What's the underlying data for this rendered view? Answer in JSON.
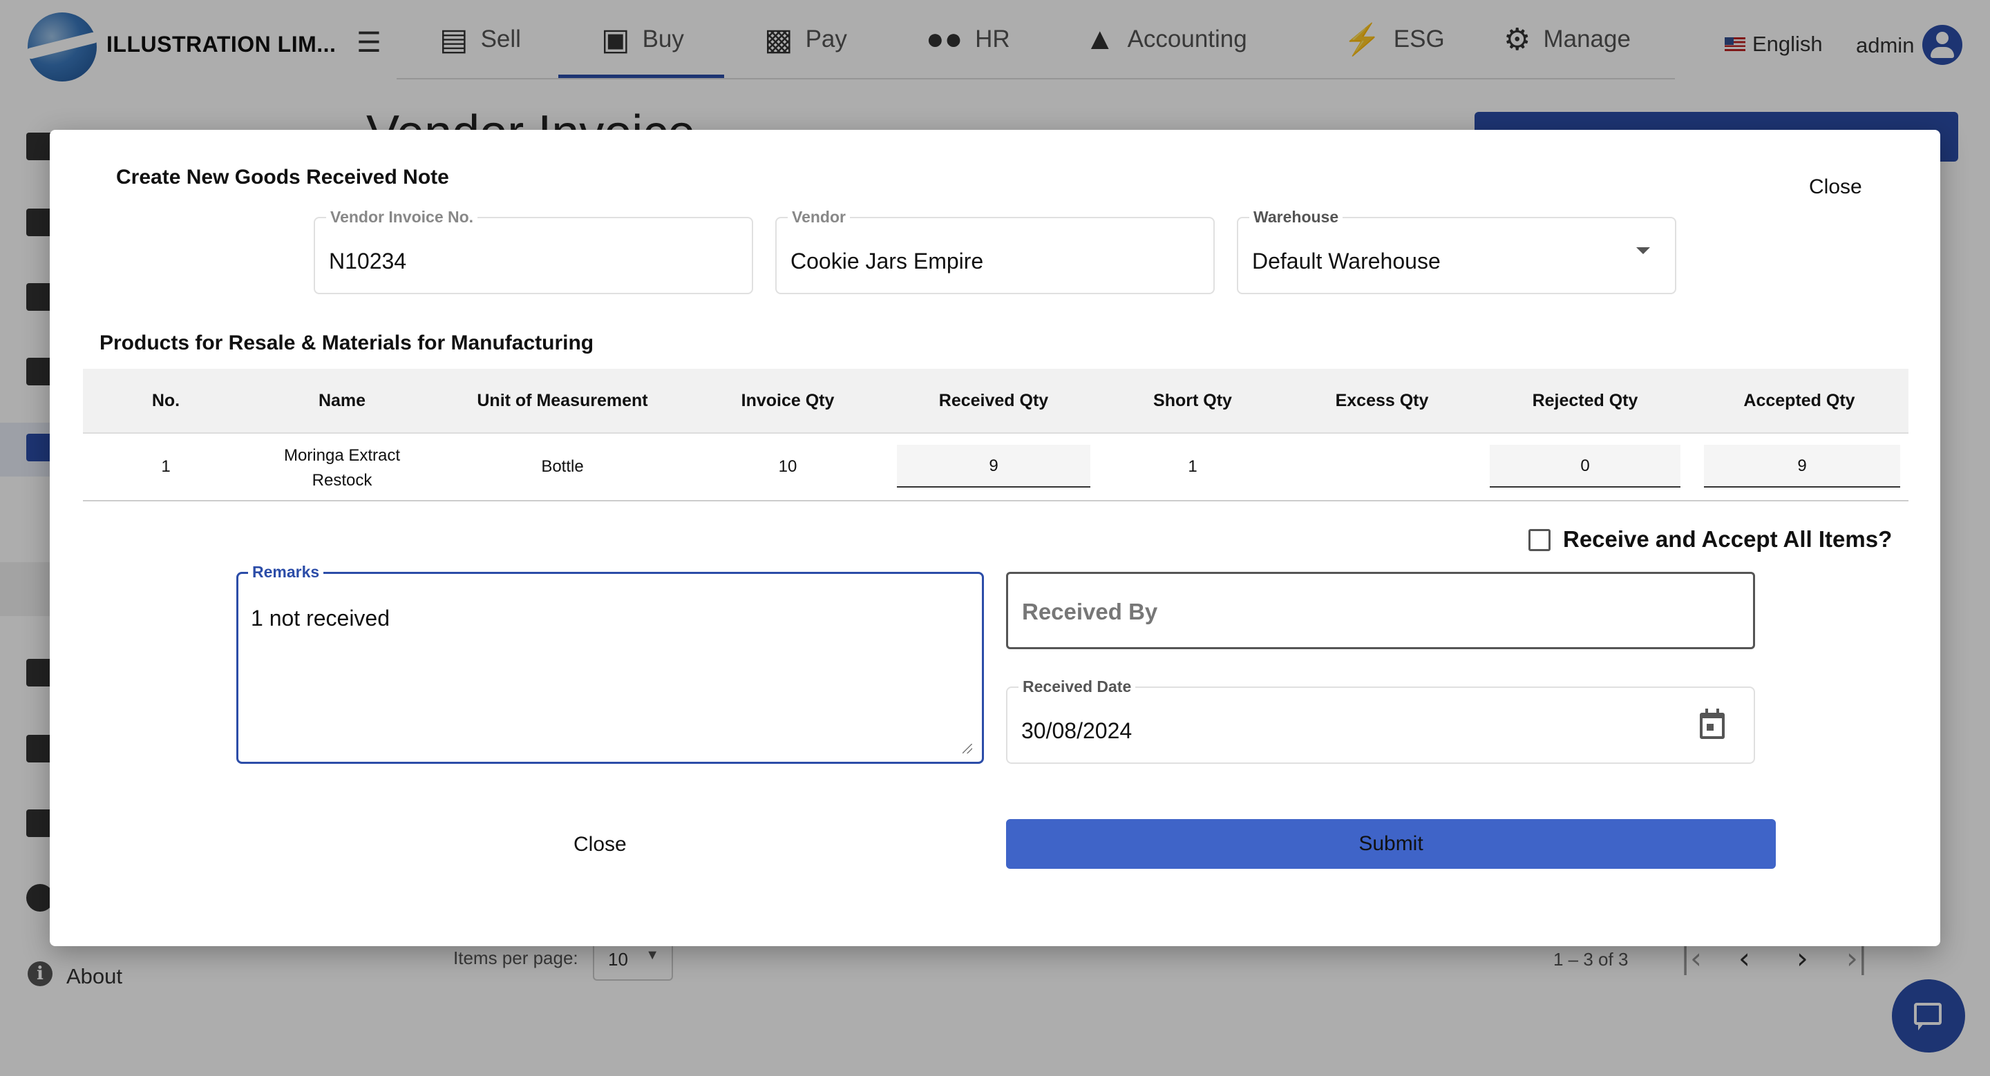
{
  "app": {
    "company_name": "ILLUSTRATION LIM...",
    "menu_icon": "hamburger-menu-icon"
  },
  "nav": {
    "items": [
      {
        "label": "Sell",
        "icon": "store-icon"
      },
      {
        "label": "Buy",
        "icon": "shopping-bag-icon",
        "active": true
      },
      {
        "label": "Pay",
        "icon": "money-icon"
      },
      {
        "label": "HR",
        "icon": "people-icon"
      },
      {
        "label": "Accounting",
        "icon": "bank-icon"
      },
      {
        "label": "ESG",
        "icon": "bolt-icon"
      },
      {
        "label": "Manage",
        "icon": "gears-icon"
      }
    ],
    "language": "English",
    "user": "admin"
  },
  "background_page": {
    "title": "Vendor Invoice",
    "about": "About",
    "items_per_page_label": "Items per page:",
    "items_per_page_value": "10",
    "range_label": "1 – 3 of 3"
  },
  "modal": {
    "title": "Create New Goods Received Note",
    "close_top": "Close",
    "vendor_invoice_no": {
      "label": "Vendor Invoice No.",
      "value": "N10234"
    },
    "vendor": {
      "label": "Vendor",
      "value": "Cookie Jars Empire"
    },
    "warehouse": {
      "label": "Warehouse",
      "value": "Default Warehouse"
    },
    "section_title": "Products for Resale & Materials for Manufacturing",
    "table": {
      "headers": [
        "No.",
        "Name",
        "Unit of Measurement",
        "Invoice Qty",
        "Received Qty",
        "Short Qty",
        "Excess Qty",
        "Rejected Qty",
        "Accepted Qty"
      ],
      "rows": [
        {
          "no": "1",
          "name_line1": "Moringa Extract",
          "name_line2": "Restock",
          "uom": "Bottle",
          "invoice_qty": "10",
          "received_qty": "9",
          "short_qty": "1",
          "excess_qty": "",
          "rejected_qty": "0",
          "accepted_qty": "9"
        }
      ]
    },
    "receive_all_label": "Receive and Accept All Items?",
    "remarks": {
      "label": "Remarks",
      "value": "1 not received"
    },
    "received_by": {
      "placeholder": "Received By"
    },
    "received_date": {
      "label": "Received Date",
      "value": "30/08/2024"
    },
    "close_bottom": "Close",
    "submit": "Submit"
  },
  "colors": {
    "accent": "#2c4da8",
    "submit": "#3f64c8"
  }
}
